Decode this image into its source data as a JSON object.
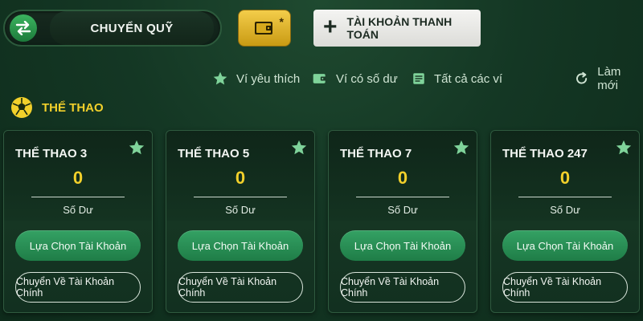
{
  "header": {
    "transfer_label": "CHUYỂN QUỸ",
    "wallet_badge": "*",
    "payment_account_label": "TÀI KHOẢN THANH TOÁN"
  },
  "filters": [
    {
      "label": "Ví yêu thích",
      "icon": "star-icon"
    },
    {
      "label": "Ví có số dư",
      "icon": "wallet-icon"
    },
    {
      "label": "Tất cả các ví",
      "icon": "wallet-list-icon"
    },
    {
      "label": "Làm mới",
      "icon": "refresh-icon"
    }
  ],
  "section": {
    "title": "THỂ THAO",
    "icon": "soccer-ball-icon"
  },
  "cards": [
    {
      "name": "THỂ THAO 3",
      "balance": "0",
      "balance_label": "Số Dư",
      "select_label": "Lựa Chọn Tài Khoản",
      "main_label": "Chuyển Về Tài Khoản Chính"
    },
    {
      "name": "THỂ THAO 5",
      "balance": "0",
      "balance_label": "Số Dư",
      "select_label": "Lựa Chọn Tài Khoản",
      "main_label": "Chuyển Về Tài Khoản Chính"
    },
    {
      "name": "THỂ THAO 7",
      "balance": "0",
      "balance_label": "Số Dư",
      "select_label": "Lựa Chọn Tài Khoản",
      "main_label": "Chuyển Về Tài Khoản Chính"
    },
    {
      "name": "THỂ THAO 247",
      "balance": "0",
      "balance_label": "Số Dư",
      "select_label": "Lựa Chọn Tài Khoản",
      "main_label": "Chuyển Về Tài Khoản Chính"
    }
  ],
  "colors": {
    "accent_yellow": "#f2d02b",
    "button_green": "#2a8f55",
    "background": "#143724"
  }
}
